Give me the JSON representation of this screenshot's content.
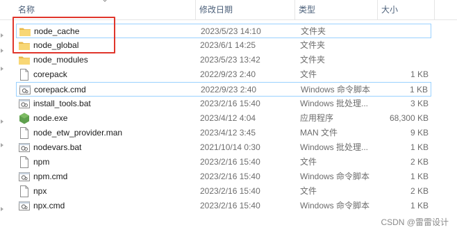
{
  "columns": {
    "name": "名称",
    "date": "修改日期",
    "type": "类型",
    "size": "大小"
  },
  "files": [
    {
      "name": "node_cache",
      "date": "2023/5/23 14:10",
      "type": "文件夹",
      "size": "",
      "icon": "folder-icon",
      "selected": true
    },
    {
      "name": "node_global",
      "date": "2023/6/1 14:25",
      "type": "文件夹",
      "size": "",
      "icon": "folder-icon",
      "selected": false
    },
    {
      "name": "node_modules",
      "date": "2023/5/23 13:42",
      "type": "文件夹",
      "size": "",
      "icon": "folder-icon",
      "selected": false
    },
    {
      "name": "corepack",
      "date": "2022/9/23 2:40",
      "type": "文件",
      "size": "1 KB",
      "icon": "file-icon",
      "selected": false
    },
    {
      "name": "corepack.cmd",
      "date": "2022/9/23 2:40",
      "type": "Windows 命令脚本",
      "size": "1 KB",
      "icon": "cmd-script-icon",
      "selected": true
    },
    {
      "name": "install_tools.bat",
      "date": "2023/2/16 15:40",
      "type": "Windows 批处理...",
      "size": "3 KB",
      "icon": "batch-file-icon",
      "selected": false
    },
    {
      "name": "node.exe",
      "date": "2023/4/12 4:04",
      "type": "应用程序",
      "size": "68,300 KB",
      "icon": "node-exe-icon",
      "selected": false
    },
    {
      "name": "node_etw_provider.man",
      "date": "2023/4/12 3:45",
      "type": "MAN 文件",
      "size": "9 KB",
      "icon": "file-icon",
      "selected": false
    },
    {
      "name": "nodevars.bat",
      "date": "2021/10/14 0:30",
      "type": "Windows 批处理...",
      "size": "1 KB",
      "icon": "batch-file-icon",
      "selected": false
    },
    {
      "name": "npm",
      "date": "2023/2/16 15:40",
      "type": "文件",
      "size": "2 KB",
      "icon": "file-icon",
      "selected": false
    },
    {
      "name": "npm.cmd",
      "date": "2023/2/16 15:40",
      "type": "Windows 命令脚本",
      "size": "1 KB",
      "icon": "cmd-script-icon",
      "selected": false
    },
    {
      "name": "npx",
      "date": "2023/2/16 15:40",
      "type": "文件",
      "size": "2 KB",
      "icon": "file-icon",
      "selected": false
    },
    {
      "name": "npx.cmd",
      "date": "2023/2/16 15:40",
      "type": "Windows 命令脚本",
      "size": "1 KB",
      "icon": "cmd-script-icon",
      "selected": false
    }
  ],
  "watermark": "CSDN @雷雷设计",
  "colors": {
    "header_text": "#4c607a",
    "folder": "#f8d775",
    "selection_border": "#99d1ff",
    "highlight": "#e0352b",
    "node_green": "#5fa04e"
  }
}
